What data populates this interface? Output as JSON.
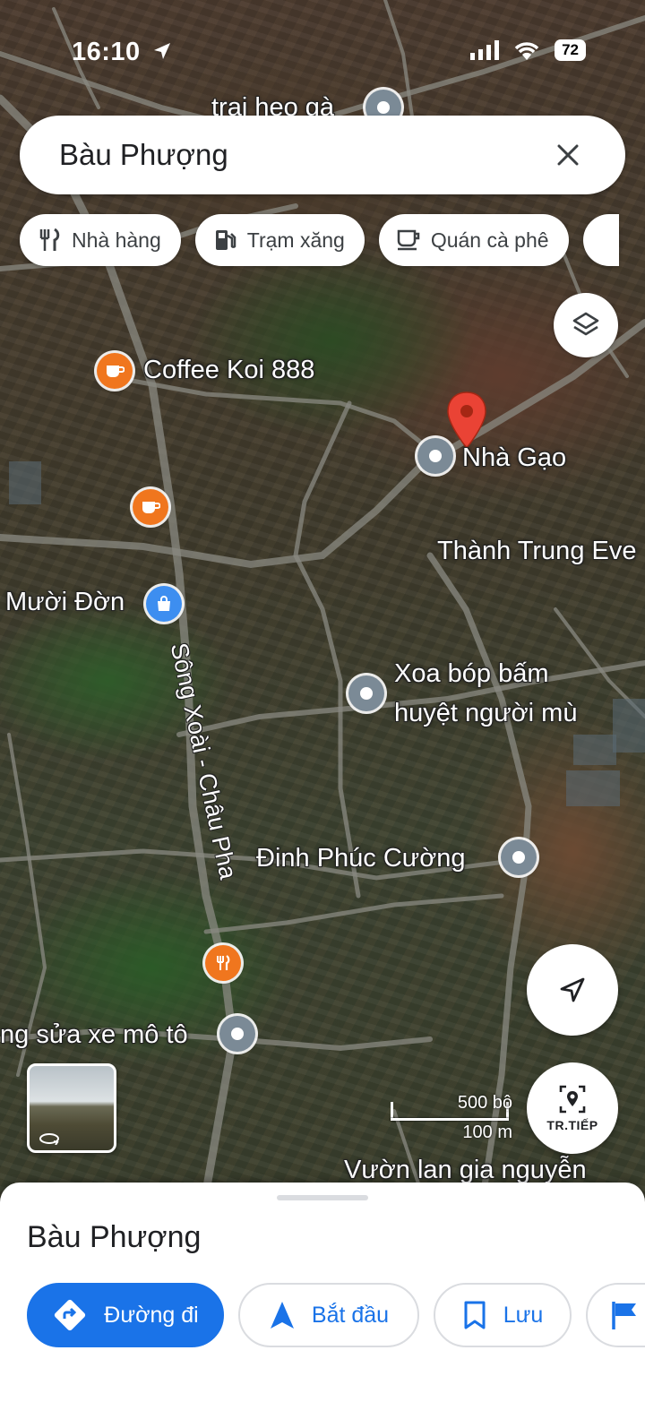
{
  "status_bar": {
    "time": "16:10",
    "battery": "72"
  },
  "search": {
    "query": "Bàu Phượng"
  },
  "chips": [
    {
      "label": "Nhà hàng",
      "icon": "fork-knife-icon"
    },
    {
      "label": "Trạm xăng",
      "icon": "gas-station-icon"
    },
    {
      "label": "Quán cà phê",
      "icon": "coffee-cup-icon"
    }
  ],
  "map_labels": {
    "trai_heo": "trai heo gà",
    "coffee_koi": "Coffee Koi 888",
    "nha_gao": "Nhà Gạo",
    "thanh_trung": "Thành Trung Eve",
    "muoi_don": "Mười Đờn",
    "xoa_bop_1": "Xoa bóp bấm",
    "xoa_bop_2": "huyệt người mù",
    "dinh_phuc_cuong": "Đinh Phúc Cường",
    "sua_xe": "ng sửa xe mô tô",
    "vuon_lan": "Vườn lan gia nguyễn",
    "road_name": "Sông Xoài - Châu Pha"
  },
  "scale": {
    "feet": "500 bộ",
    "meters": "100 m"
  },
  "live_button": {
    "label": "TR.TIẾP"
  },
  "sheet": {
    "title": "Bàu Phượng",
    "directions": "Đường đi",
    "start": "Bắt đầu",
    "save": "Lưu"
  },
  "colors": {
    "accent": "#1a73e8",
    "pin_red": "#ea4335",
    "poi_orange": "#f0761e",
    "poi_gray": "#7b8a96"
  }
}
